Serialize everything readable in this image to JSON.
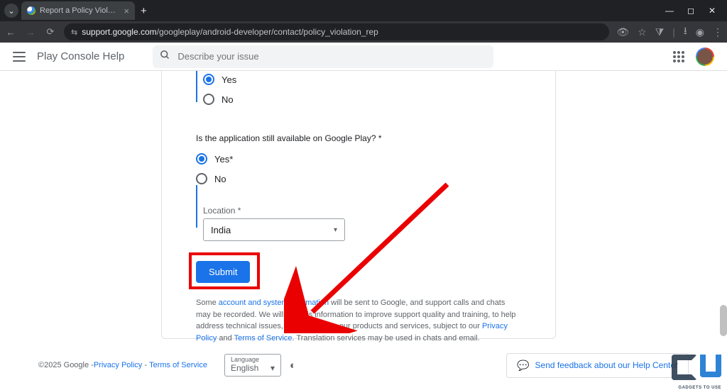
{
  "browser": {
    "tab_title": "Report a Policy Violation - Play...",
    "url_host": "support.google.com",
    "url_path": "/googleplay/android-developer/contact/policy_violation_rep"
  },
  "header": {
    "product_name": "Play Console Help",
    "search_placeholder": "Describe your issue"
  },
  "form": {
    "q1_yes": "Yes",
    "q1_no": "No",
    "q2_label": "Is the application still available on Google Play? *",
    "q2_yes": "Yes*",
    "q2_no": "No",
    "location_label": "Location *",
    "location_value": "India",
    "submit_label": "Submit"
  },
  "disclaimer": {
    "prefix": "Some ",
    "link1": "account and system information",
    "mid1": " will be sent to Google, and support calls and chats may be recorded. We will use this information to improve support quality and training, to help address technical issues, and to improve our products and services, subject to our ",
    "link2": "Privacy Policy",
    "and": " and ",
    "link3": "Terms of Service",
    "suffix": ". Translation services may be used in chats and email."
  },
  "footer": {
    "copyright": "©2025 Google - ",
    "privacy": "Privacy Policy",
    "terms": "Terms of Service",
    "lang_label": "Language",
    "lang_value": "English",
    "feedback": "Send feedback about our Help Center"
  },
  "watermark": "GADGETS TO USE"
}
